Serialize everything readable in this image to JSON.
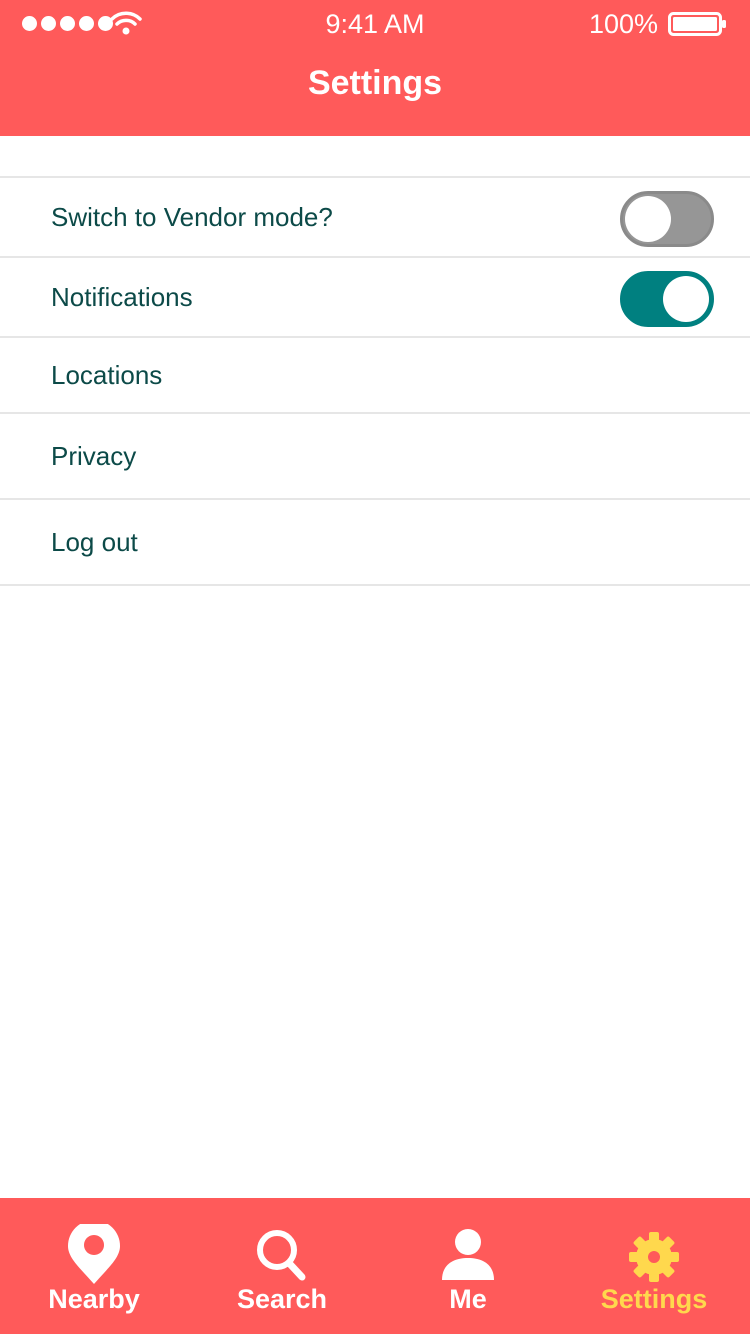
{
  "status_bar": {
    "time": "9:41 AM",
    "battery": "100%"
  },
  "header": {
    "title": "Settings"
  },
  "settings": {
    "items": [
      {
        "label": "Switch to Vendor mode?",
        "toggle": "off"
      },
      {
        "label": "Notifications",
        "toggle": "on"
      },
      {
        "label": "Locations"
      },
      {
        "label": "Privacy"
      },
      {
        "label": "Log out"
      }
    ]
  },
  "tabbar": {
    "tabs": [
      {
        "label": "Nearby",
        "icon": "map-pin-icon",
        "active": false
      },
      {
        "label": "Search",
        "icon": "search-icon",
        "active": false
      },
      {
        "label": "Me",
        "icon": "user-icon",
        "active": false
      },
      {
        "label": "Settings",
        "icon": "gear-icon",
        "active": true
      }
    ]
  },
  "colors": {
    "brand": "#FF5A5A",
    "accent": "#008080",
    "active_tab": "#FFD84D",
    "text": "#0C4A48"
  }
}
